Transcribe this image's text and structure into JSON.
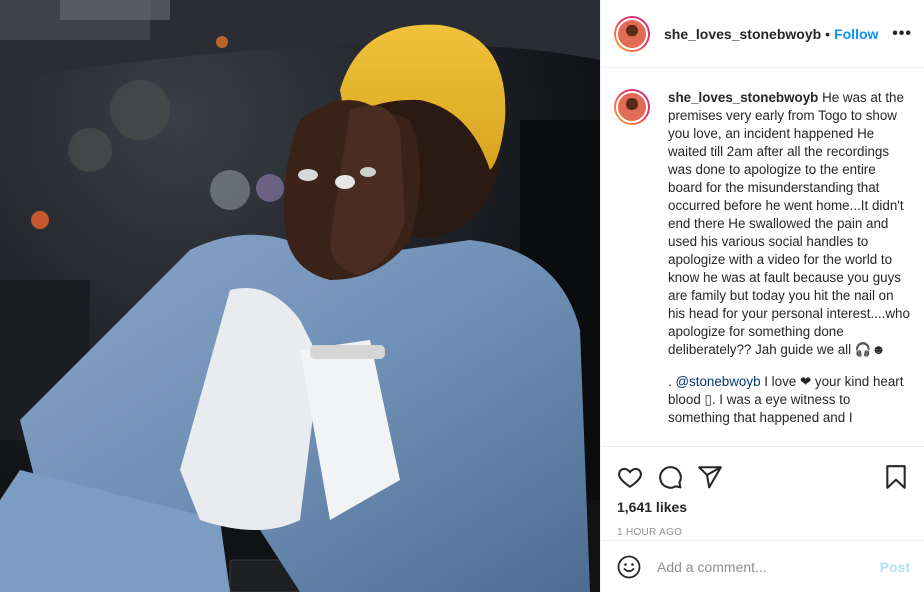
{
  "post": {
    "image_alt": "Man in yellow beanie and denim jacket covering his face with his hands inside a car",
    "author": "she_loves_stonebwoyb",
    "header_separator": "•",
    "follow_label": "Follow",
    "more_label": "•••"
  },
  "caption": {
    "username": "she_loves_stonebwoyb",
    "text": "He was at the premises very early from Togo to show you love, an incident happened He waited till 2am after all the recordings was done to apologize to the entire board for the misunderstanding that occurred before he went home...It didn't end there He swallowed the pain and used his various social handles to apologize with a video for the world to know he was at fault because you guys are family but today you hit the nail on his head for your personal interest....who apologize for something done deliberately?? Jah guide we all 🎧☻"
  },
  "comment": {
    "prefix": ". ",
    "mention": "@stonebwoyb",
    "text": " I love ❤ your kind heart blood ▯. I was a eye witness to something that happened and I"
  },
  "actions": {
    "icons": [
      "heart-icon",
      "comment-icon",
      "share-icon",
      "bookmark-icon"
    ],
    "likes": "1,641 likes",
    "time": "1 HOUR AGO"
  },
  "add_comment": {
    "icon": "smile-icon",
    "placeholder": "Add a comment...",
    "post_label": "Post"
  },
  "colors": {
    "link": "#0095f6",
    "post_disabled": "#b2dffc",
    "beanie": "#e5b52b",
    "denim": "#6f8fb5"
  }
}
